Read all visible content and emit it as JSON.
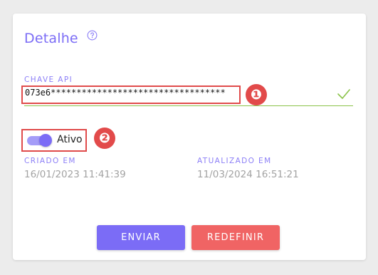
{
  "details": {
    "title": "Detalhe",
    "help_icon": "help-circle-icon"
  },
  "api_key": {
    "label": "CHAVE API",
    "value": "073e6**********************************",
    "valid_icon": "check-icon",
    "annotation_number": "❶"
  },
  "status": {
    "toggle_label": "Ativo",
    "enabled": true,
    "annotation_number": "❷"
  },
  "meta": {
    "created_label": "CRIADO EM",
    "created_value": "16/01/2023 11:41:39",
    "updated_label": "ATUALIZADO EM",
    "updated_value": "11/03/2024 16:51:21"
  },
  "actions": {
    "send_label": "ENVIAR",
    "reset_label": "REDEFINIR"
  },
  "colors": {
    "accent": "#7b6cf6",
    "danger": "#f06464",
    "valid": "#8bc34a",
    "annotation": "#e24a4a"
  }
}
